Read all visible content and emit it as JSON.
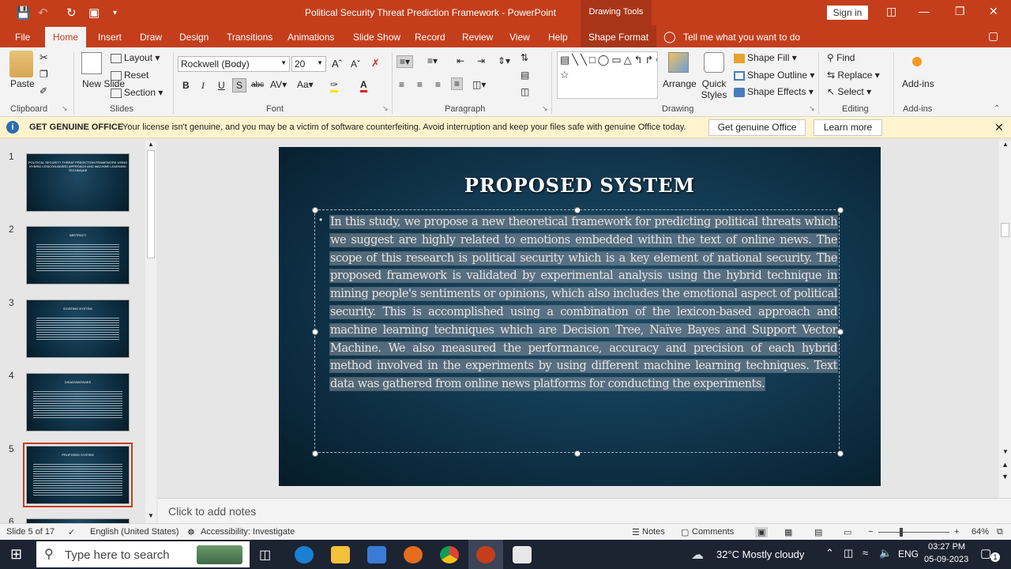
{
  "window": {
    "title": "Political Security Threat Prediction Framework  -  PowerPoint",
    "drawing_tools": "Drawing Tools",
    "sign_in": "Sign in"
  },
  "tabs": [
    "File",
    "Home",
    "Insert",
    "Draw",
    "Design",
    "Transitions",
    "Animations",
    "Slide Show",
    "Record",
    "Review",
    "View",
    "Help",
    "Shape Format"
  ],
  "tell_me": "Tell me what you want to do",
  "ribbon": {
    "clipboard": {
      "label": "Clipboard",
      "paste": "Paste"
    },
    "slides": {
      "label": "Slides",
      "new_slide": "New Slide",
      "layout": "Layout",
      "reset": "Reset",
      "section": "Section"
    },
    "font": {
      "label": "Font",
      "font_name": "Rockwell (Body)",
      "font_size": "20"
    },
    "paragraph": {
      "label": "Paragraph"
    },
    "drawing": {
      "label": "Drawing",
      "arrange": "Arrange",
      "quick_styles": "Quick Styles",
      "shape_fill": "Shape Fill",
      "shape_outline": "Shape Outline",
      "shape_effects": "Shape Effects"
    },
    "editing": {
      "label": "Editing",
      "find": "Find",
      "replace": "Replace",
      "select": "Select"
    },
    "addins": {
      "label": "Add-ins",
      "addins": "Add-ins"
    }
  },
  "infobar": {
    "title": "GET GENUINE OFFICE",
    "message": "Your license isn't genuine, and you may be a victim of software counterfeiting. Avoid interruption and keep your files safe with genuine Office today.",
    "btn_genuine": "Get genuine Office",
    "btn_learn": "Learn more"
  },
  "thumbnails": [
    {
      "num": "1",
      "title": "POLITICAL SECURITY THREAT PREDICTION FRAMEWORK USING HYBRID LEXICON-BASED APPROACH AND MACHINE LEARNING TECHNIQUE"
    },
    {
      "num": "2",
      "title": "ABSTRACT"
    },
    {
      "num": "3",
      "title": "EXISTING SYSTEM"
    },
    {
      "num": "4",
      "title": "DISADVANTAGES"
    },
    {
      "num": "5",
      "title": "PROPOSED SYSTEM"
    },
    {
      "num": "6",
      "title": ""
    }
  ],
  "slide": {
    "title": "PROPOSED  SYSTEM",
    "body": "In this study, we propose a new theoretical framework for predicting political threats which we suggest are highly related to emotions embedded within the text of online news. The scope of this research is political security which is a key element of national security. The proposed framework is validated by experimental analysis using the hybrid technique in mining people's sentiments or opinions, which also includes the emotional aspect of political security. This is accomplished using a combination of the lexicon-based approach and machine learning techniques which are Decision Tree, Naïve Bayes and Support Vector Machine. We also measured the performance, accuracy and precision of each hybrid method involved in the experiments by using different machine learning techniques. Text data was gathered from online news platforms for conducting the experiments."
  },
  "notes_placeholder": "Click to add notes",
  "status": {
    "slide_info": "Slide 5 of 17",
    "language": "English (United States)",
    "accessibility": "Accessibility: Investigate",
    "notes": "Notes",
    "comments": "Comments",
    "zoom": "64%"
  },
  "taskbar": {
    "search_placeholder": "Type here to search",
    "weather": "32°C  Mostly cloudy",
    "lang": "ENG",
    "time": "03:27 PM",
    "date": "05-09-2023",
    "notif_count": "1"
  },
  "colors": {
    "accent": "#c43e1c",
    "infobar": "#fff4ce",
    "slide_bg": "#0f3449"
  }
}
